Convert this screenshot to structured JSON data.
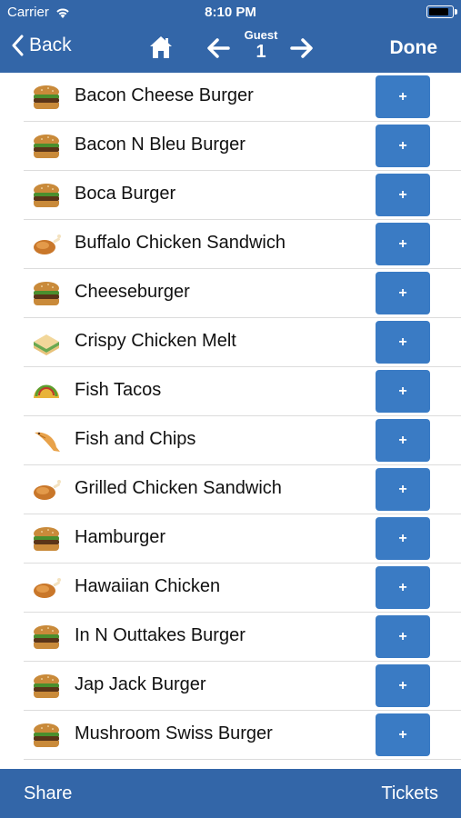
{
  "status": {
    "carrier": "Carrier",
    "time": "8:10 PM",
    "battery_level": 0.9
  },
  "nav": {
    "back_label": "Back",
    "guest_label": "Guest",
    "guest_number": "1",
    "done_label": "Done"
  },
  "menu": {
    "items": [
      {
        "name": "Bacon Cheese Burger",
        "icon": "burger-icon",
        "action": "+"
      },
      {
        "name": "Bacon N Bleu Burger",
        "icon": "burger-icon",
        "action": "+"
      },
      {
        "name": "Boca Burger",
        "icon": "burger-icon",
        "action": "+"
      },
      {
        "name": "Buffalo Chicken Sandwich",
        "icon": "chicken-icon",
        "action": "+"
      },
      {
        "name": "Cheeseburger",
        "icon": "burger-icon",
        "action": "+"
      },
      {
        "name": "Crispy Chicken Melt",
        "icon": "sandwich-icon",
        "action": "+"
      },
      {
        "name": "Fish Tacos",
        "icon": "taco-icon",
        "action": "+"
      },
      {
        "name": "Fish and Chips",
        "icon": "fish-icon",
        "action": "+"
      },
      {
        "name": "Grilled Chicken Sandwich",
        "icon": "chicken-icon",
        "action": "+"
      },
      {
        "name": "Hamburger",
        "icon": "burger-icon",
        "action": "+"
      },
      {
        "name": "Hawaiian Chicken",
        "icon": "chicken-icon",
        "action": "+"
      },
      {
        "name": "In N Outtakes Burger",
        "icon": "burger-icon",
        "action": "+"
      },
      {
        "name": "Jap Jack Burger",
        "icon": "burger-icon",
        "action": "+"
      },
      {
        "name": "Mushroom Swiss Burger",
        "icon": "burger-icon",
        "action": "+"
      }
    ]
  },
  "tabbar": {
    "share_label": "Share",
    "tickets_label": "Tickets"
  },
  "colors": {
    "bar": "#3366a8",
    "button": "#3a7bc4",
    "divider": "#dcdcdc"
  }
}
